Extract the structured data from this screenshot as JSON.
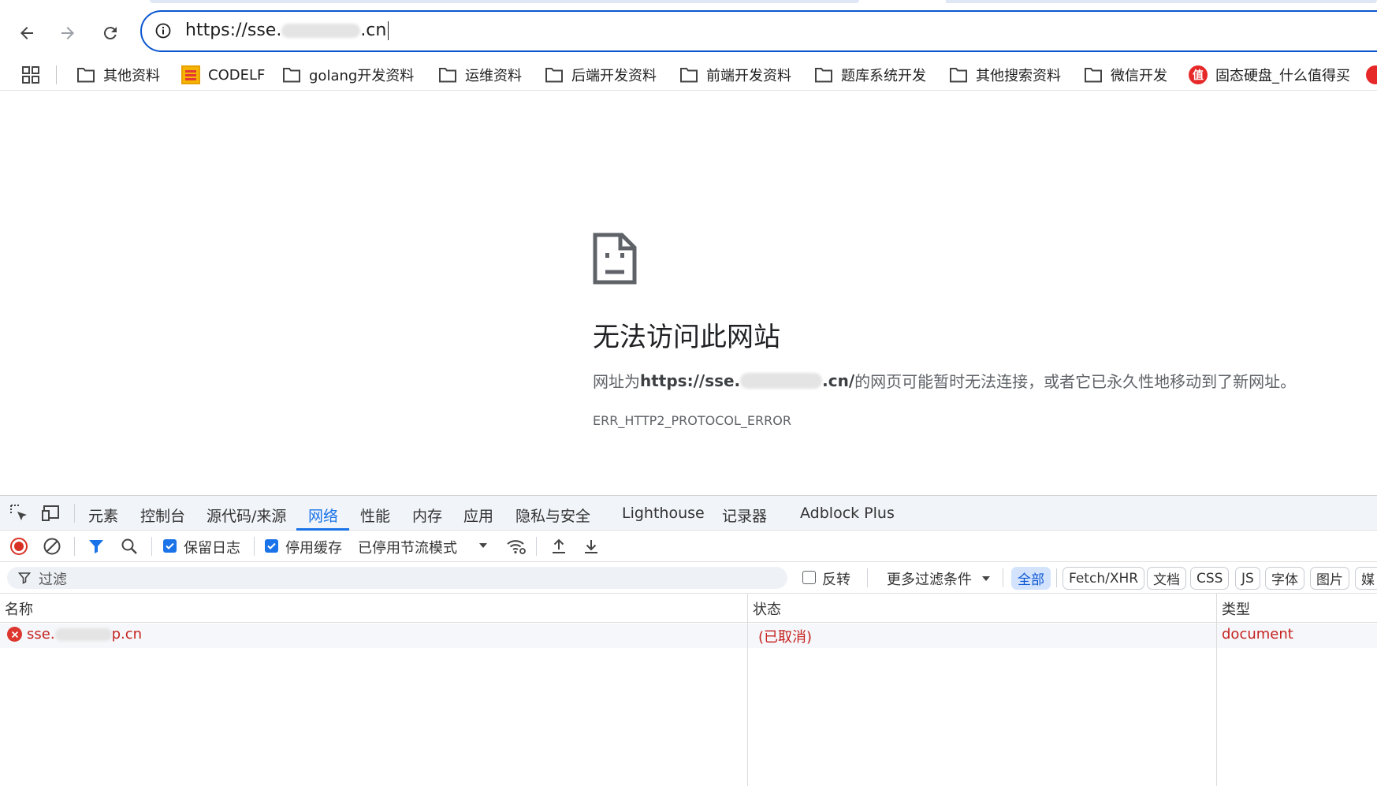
{
  "browser": {
    "url_prefix": "https://sse.",
    "url_suffix": ".cn",
    "back_icon": "arrow-left-icon",
    "forward_icon": "arrow-right-icon",
    "reload_icon": "reload-icon",
    "info_icon": "info-icon"
  },
  "bookmarks": {
    "items": [
      {
        "label": "其他资料",
        "icon": "folder-icon"
      },
      {
        "label": "CODELF",
        "icon": "codelf-icon"
      },
      {
        "label": "golang开发资料",
        "icon": "folder-icon"
      },
      {
        "label": "运维资料",
        "icon": "folder-icon"
      },
      {
        "label": "后端开发资料",
        "icon": "folder-icon"
      },
      {
        "label": "前端开发资料",
        "icon": "folder-icon"
      },
      {
        "label": "题库系统开发",
        "icon": "folder-icon"
      },
      {
        "label": "其他搜索资料",
        "icon": "folder-icon"
      },
      {
        "label": "微信开发",
        "icon": "folder-icon"
      },
      {
        "label": "固态硬盘_什么值得买",
        "icon": "zhi-icon"
      }
    ],
    "zhi_glyph": "值"
  },
  "error_page": {
    "title": "无法访问此网站",
    "desc_prefix": "网址为 ",
    "desc_url_prefix": "https://sse.",
    "desc_url_suffix": ".cn/",
    "desc_suffix": " 的网页可能暂时无法连接，或者它已永久性地移动到了新网址。",
    "error_code": "ERR_HTTP2_PROTOCOL_ERROR"
  },
  "devtools": {
    "tabs": [
      "元素",
      "控制台",
      "源代码/来源",
      "网络",
      "性能",
      "内存",
      "应用",
      "隐私与安全",
      "Lighthouse",
      "记录器",
      "Adblock Plus"
    ],
    "active_tab": "网络",
    "toolbar": {
      "preserve_log_label": "保留日志",
      "preserve_log_checked": true,
      "disable_cache_label": "停用缓存",
      "disable_cache_checked": true,
      "throttling_label": "已停用节流模式"
    },
    "filter": {
      "placeholder": "过滤",
      "invert_label": "反转",
      "more_filters_label": "更多过滤条件",
      "type_chips": [
        "全部",
        "Fetch/XHR",
        "文档",
        "CSS",
        "JS",
        "字体",
        "图片",
        "媒"
      ],
      "active_chip": "全部"
    },
    "table": {
      "columns": [
        "名称",
        "状态",
        "类型"
      ],
      "rows": [
        {
          "name_prefix": "sse.",
          "name_suffix": "p.cn",
          "status": "(已取消)",
          "type": "document"
        }
      ]
    }
  },
  "colors": {
    "accent": "#1a73e8",
    "omnibox_border": "#0b57d0",
    "error_red": "#c5221f"
  }
}
